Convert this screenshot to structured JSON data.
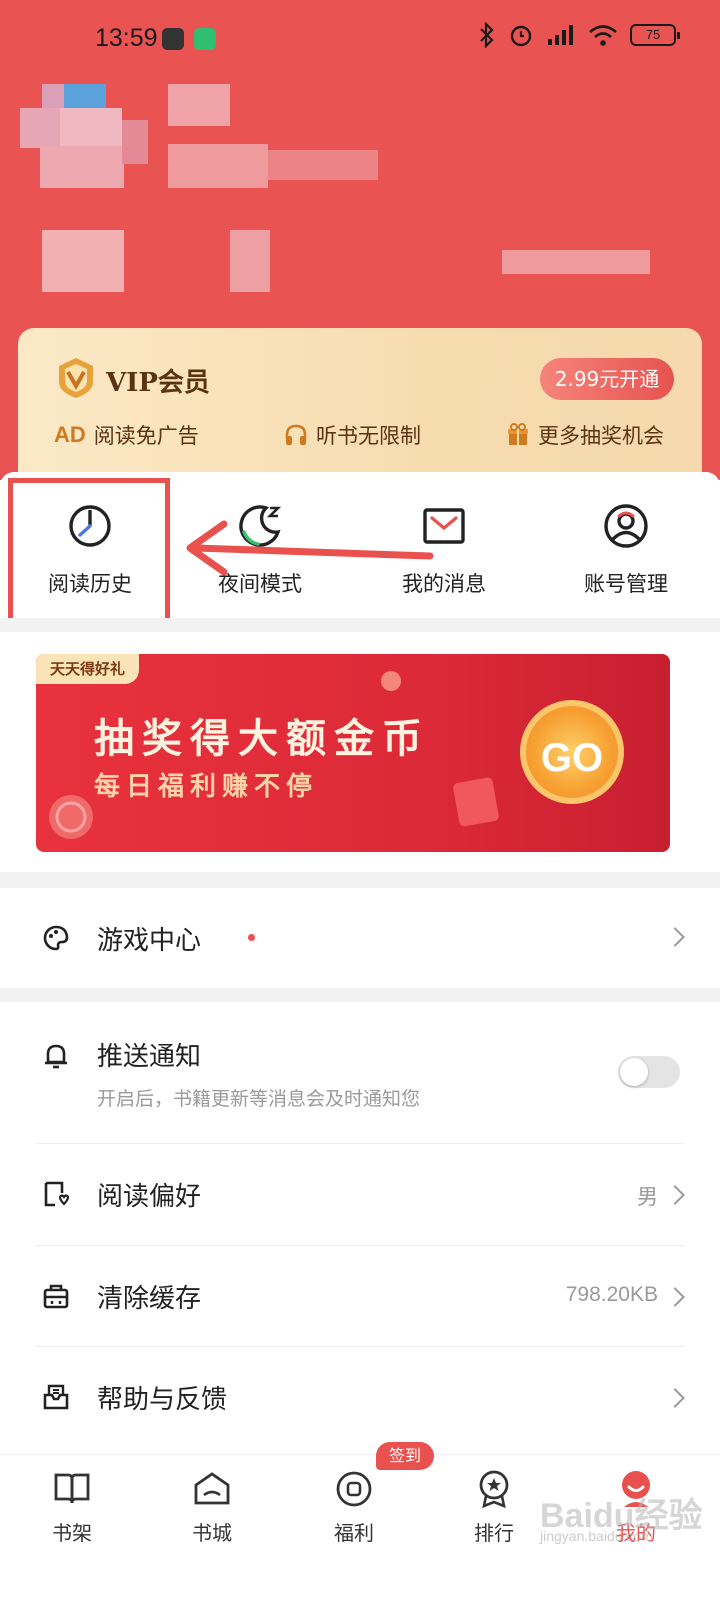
{
  "status_bar": {
    "time": "13:59",
    "battery": "75"
  },
  "vip": {
    "title": "VIP会员",
    "button": "2.99元开通",
    "features": [
      {
        "badge": "AD",
        "label": "阅读免广告",
        "icon": "ad-icon"
      },
      {
        "label": "听书无限制",
        "icon": "headphones-icon"
      },
      {
        "label": "更多抽奖机会",
        "icon": "gift-icon"
      }
    ]
  },
  "quick_actions": [
    {
      "label": "阅读历史",
      "icon": "history-clock-icon"
    },
    {
      "label": "夜间模式",
      "icon": "night-mode-icon"
    },
    {
      "label": "我的消息",
      "icon": "message-envelope-icon"
    },
    {
      "label": "账号管理",
      "icon": "account-user-icon"
    }
  ],
  "banner": {
    "tag": "天天得好礼",
    "title": "抽奖得大额金币",
    "subtitle": "每日福利赚不停",
    "cta": "GO"
  },
  "menu": {
    "game_center": {
      "title": "游戏中心",
      "icon": "game-palette-icon"
    },
    "push": {
      "title": "推送通知",
      "subtitle": "开启后，书籍更新等消息会及时通知您",
      "enabled": false,
      "icon": "bell-icon"
    },
    "reading_pref": {
      "title": "阅读偏好",
      "value": "男",
      "icon": "preference-book-icon"
    },
    "clear_cache": {
      "title": "清除缓存",
      "value": "798.20KB",
      "icon": "cache-box-icon"
    },
    "help": {
      "title": "帮助与反馈",
      "icon": "help-tray-icon"
    }
  },
  "tabs": [
    {
      "label": "书架",
      "icon": "bookshelf-icon"
    },
    {
      "label": "书城",
      "icon": "bookstore-icon"
    },
    {
      "label": "福利",
      "icon": "welfare-icon",
      "badge": "签到"
    },
    {
      "label": "排行",
      "icon": "ranking-medal-icon"
    },
    {
      "label": "我的",
      "icon": "profile-icon",
      "active": true
    }
  ],
  "colors": {
    "primary": "#E9514E",
    "header_bg": "#E95352",
    "vip_bg": "#F8E1B8"
  },
  "watermark": {
    "logo": "Baidu经验",
    "url": "jingyan.baidu.com"
  }
}
